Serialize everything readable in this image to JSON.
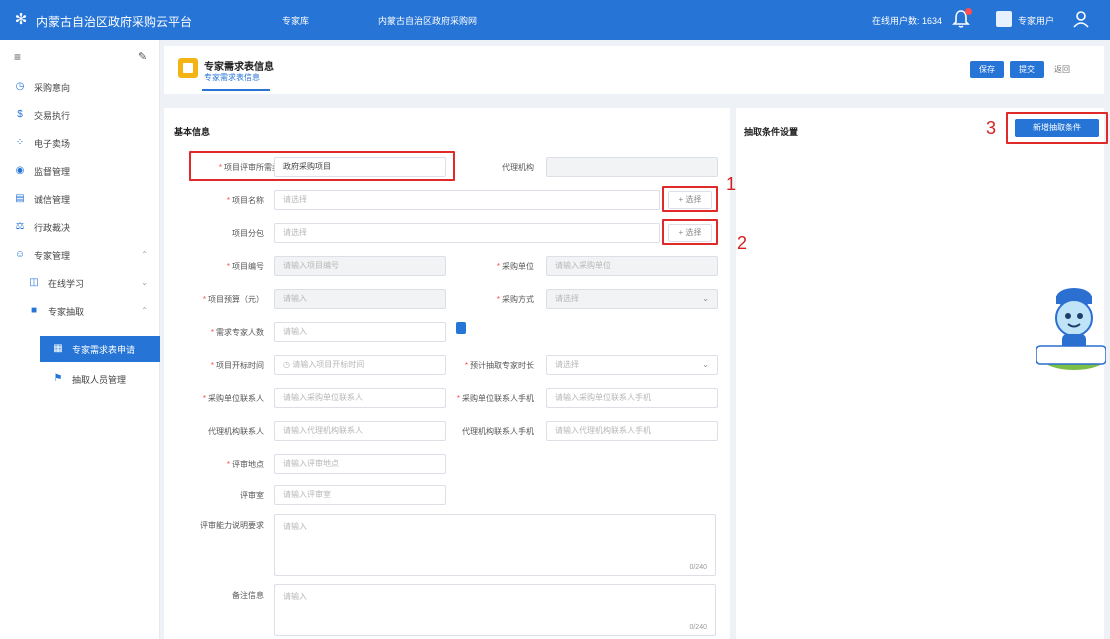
{
  "topbar": {
    "app_title": "内蒙古自治区政府采购云平台",
    "nav_tabs": [
      "专家库",
      "内蒙古自治区政府采购网"
    ],
    "online_users": "在线用户数: 1634",
    "user_name": "专家用户"
  },
  "sidebar": {
    "items": [
      {
        "label": "采购意向"
      },
      {
        "label": "交易执行"
      },
      {
        "label": "电子卖场"
      },
      {
        "label": "监督管理"
      },
      {
        "label": "诚信管理"
      },
      {
        "label": "行政裁决"
      },
      {
        "label": "专家管理"
      },
      {
        "label": "在线学习"
      },
      {
        "label": "专家抽取"
      },
      {
        "label": "专家需求表申请"
      },
      {
        "label": "抽取人员管理"
      }
    ]
  },
  "page": {
    "title": "专家需求表信息",
    "subtitle": "专家需求表信息",
    "save_label": "保存",
    "submit_label": "提交",
    "back_label": "返回"
  },
  "basic_info": {
    "section_title": "基本信息",
    "fields": {
      "project_type": {
        "label": "项目评审所需类型",
        "value": "政府采购项目"
      },
      "agency": {
        "label": "代理机构",
        "value": ""
      },
      "project_name": {
        "label": "项目名称",
        "placeholder": "请选择",
        "select_label": "选择"
      },
      "project_package": {
        "label": "项目分包",
        "placeholder": "请选择",
        "select_label": "选择"
      },
      "project_code": {
        "label": "项目编号",
        "placeholder": "请输入项目编号"
      },
      "purchaser": {
        "label": "采购单位",
        "value": "请输入采购单位"
      },
      "budget": {
        "label": "项目预算（元）",
        "placeholder": "请输入"
      },
      "purchase_method": {
        "label": "采购方式",
        "placeholder": "请选择"
      },
      "expert_count": {
        "label": "需求专家人数",
        "placeholder": "请输入"
      },
      "review_time": {
        "label": "项目开标时间",
        "placeholder": "请输入项目开标时间"
      },
      "extract_time": {
        "label": "预计抽取专家时长",
        "placeholder": "请选择"
      },
      "purchaser_contact": {
        "label": "采购单位联系人",
        "placeholder": "请输入采购单位联系人"
      },
      "purchaser_phone": {
        "label": "采购单位联系人手机",
        "placeholder": "请输入采购单位联系人手机"
      },
      "agency_contact": {
        "label": "代理机构联系人",
        "placeholder": "请输入代理机构联系人"
      },
      "agency_phone": {
        "label": "代理机构联系人手机",
        "placeholder": "请输入代理机构联系人手机"
      },
      "review_location": {
        "label": "评审地点",
        "placeholder": "请输入评审地点"
      },
      "review_room": {
        "label": "评审室",
        "placeholder": "请输入评审室"
      },
      "expert_notice": {
        "label": "评审能力说明要求",
        "placeholder": "请输入",
        "count": "0/240"
      },
      "remarks": {
        "label": "备注信息",
        "placeholder": "请输入",
        "count": "0/240"
      }
    }
  },
  "extract_conditions": {
    "section_title": "抽取条件设置",
    "add_label": "新增抽取条件"
  },
  "annotations": [
    "1",
    "2",
    "3"
  ],
  "colors": {
    "primary": "#2574d6",
    "highlight": "#e02a2a",
    "badge": "#f3b315"
  }
}
